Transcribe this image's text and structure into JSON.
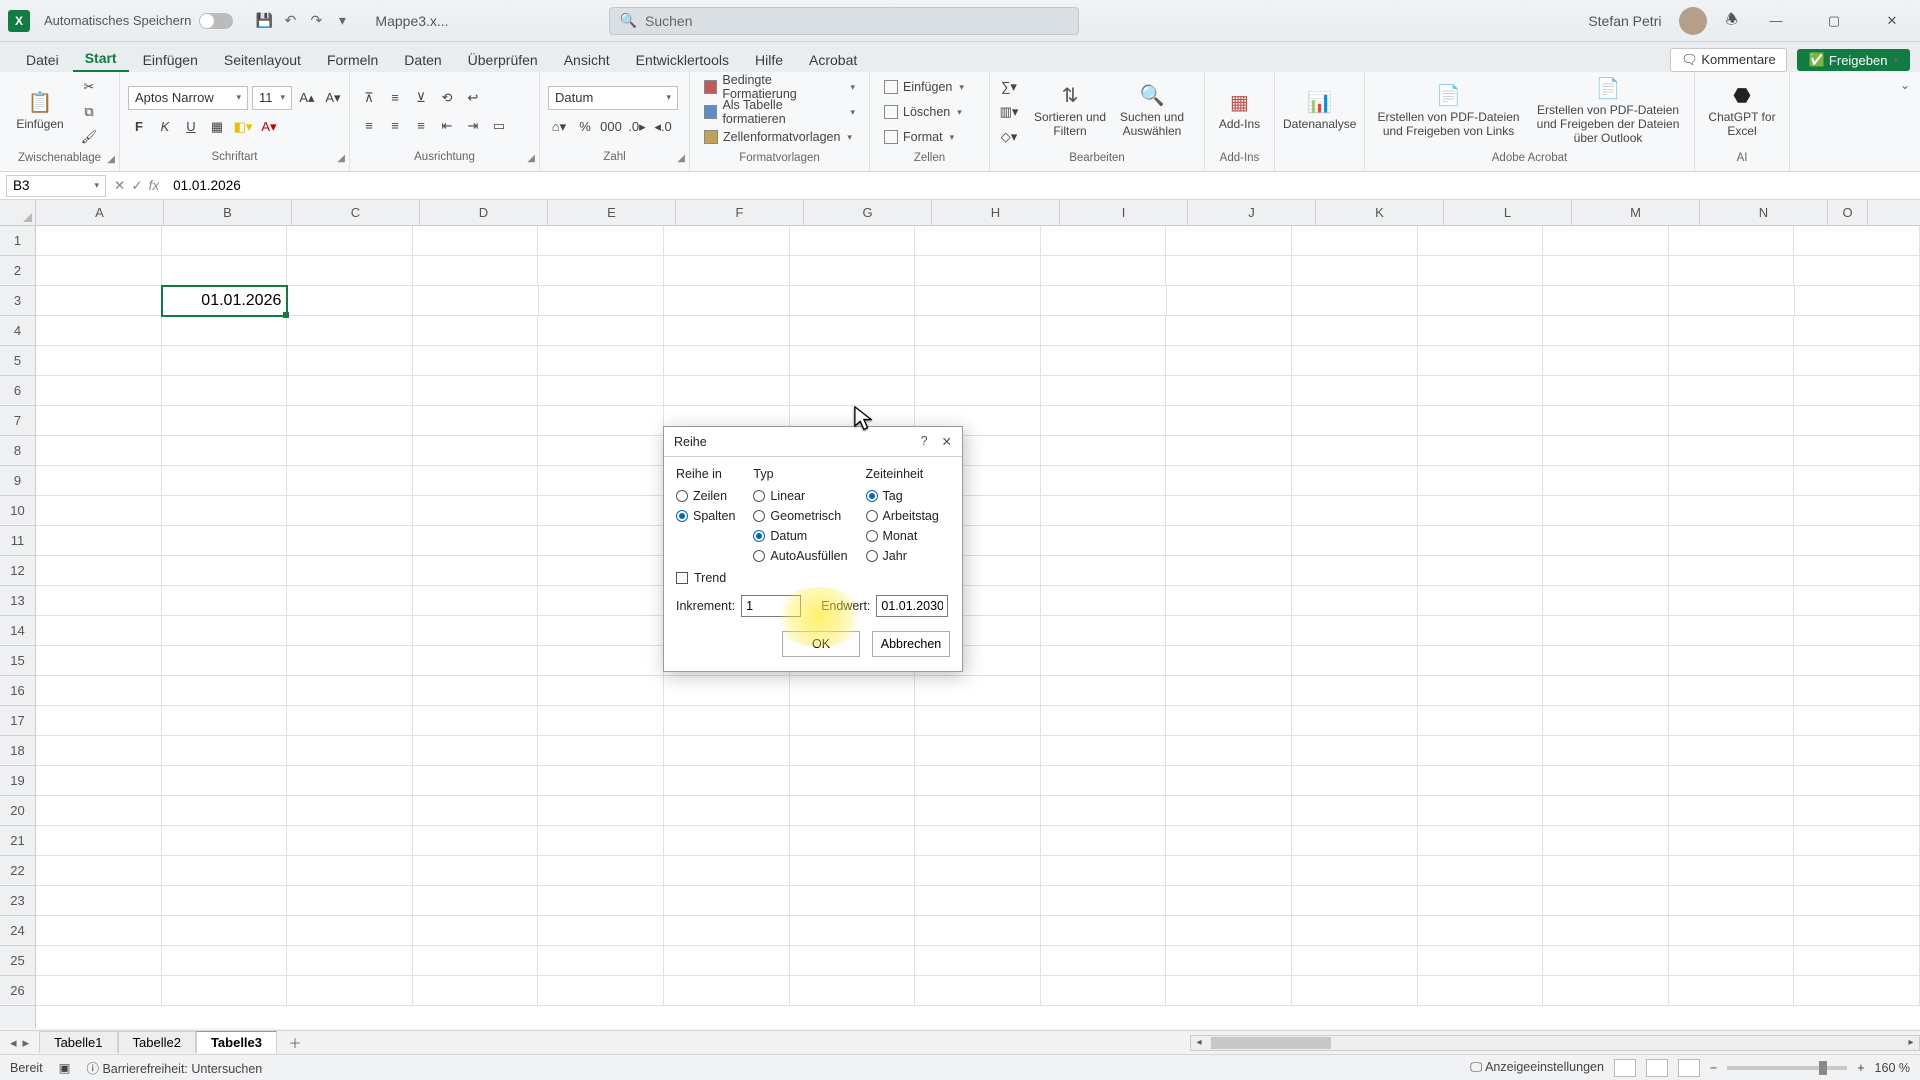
{
  "title": {
    "autosave": "Automatisches Speichern",
    "docname": "Mappe3.x...",
    "search_placeholder": "Suchen",
    "user": "Stefan Petri"
  },
  "menutabs": [
    "Datei",
    "Start",
    "Einfügen",
    "Seitenlayout",
    "Formeln",
    "Daten",
    "Überprüfen",
    "Ansicht",
    "Entwicklertools",
    "Hilfe",
    "Acrobat"
  ],
  "menutabs_active": 1,
  "actions": {
    "comments": "Kommentare",
    "share": "Freigeben"
  },
  "ribbon": {
    "groups": {
      "clipboard": {
        "label": "Zwischenablage",
        "paste": "Einfügen"
      },
      "font": {
        "label": "Schriftart",
        "name": "Aptos Narrow",
        "size": "11"
      },
      "align": {
        "label": "Ausrichtung"
      },
      "number": {
        "label": "Zahl",
        "format": "Datum"
      },
      "styles": {
        "label": "Formatvorlagen",
        "i1": "Bedingte Formatierung",
        "i2": "Als Tabelle formatieren",
        "i3": "Zellenformatvorlagen"
      },
      "cells": {
        "label": "Zellen",
        "i1": "Einfügen",
        "i2": "Löschen",
        "i3": "Format"
      },
      "editing": {
        "label": "Bearbeiten",
        "sort": "Sortieren und Filtern",
        "find": "Suchen und Auswählen"
      },
      "addins": {
        "label": "Add-Ins",
        "btn": "Add-Ins"
      },
      "analysis": {
        "btn": "Datenanalyse"
      },
      "acrobat": {
        "label": "Adobe Acrobat",
        "b1": "Erstellen von PDF-Dateien und Freigeben von Links",
        "b2": "Erstellen von PDF-Dateien und Freigeben der Dateien über Outlook"
      },
      "ai": {
        "label": "AI",
        "btn": "ChatGPT for Excel"
      }
    }
  },
  "formula": {
    "namebox": "B3",
    "value": "01.01.2026"
  },
  "columns": [
    "A",
    "B",
    "C",
    "D",
    "E",
    "F",
    "G",
    "H",
    "I",
    "J",
    "K",
    "L",
    "M",
    "N",
    "O"
  ],
  "rows": [
    1,
    2,
    3,
    4,
    5,
    6,
    7,
    8,
    9,
    10,
    11,
    12,
    13,
    14,
    15,
    16,
    17,
    18,
    19,
    20,
    21,
    22,
    23,
    24,
    25,
    26
  ],
  "selected_cell_value": "01.01.2026",
  "dialog": {
    "title": "Reihe",
    "group_in": {
      "label": "Reihe in",
      "o1": "Zeilen",
      "o2": "Spalten"
    },
    "group_typ": {
      "label": "Typ",
      "o1": "Linear",
      "o2": "Geometrisch",
      "o3": "Datum",
      "o4": "AutoAusfüllen"
    },
    "group_time": {
      "label": "Zeiteinheit",
      "o1": "Tag",
      "o2": "Arbeitstag",
      "o3": "Monat",
      "o4": "Jahr"
    },
    "trend": "Trend",
    "inc_label": "Inkrement:",
    "inc_value": "1",
    "end_label": "Endwert:",
    "end_value": "01.01.2030",
    "ok": "OK",
    "cancel": "Abbrechen"
  },
  "sheets": {
    "tabs": [
      "Tabelle1",
      "Tabelle2",
      "Tabelle3"
    ],
    "active": 2
  },
  "status": {
    "ready": "Bereit",
    "access": "Barrierefreiheit: Untersuchen",
    "disp": "Anzeigeeinstellungen",
    "zoom": "160 %"
  }
}
